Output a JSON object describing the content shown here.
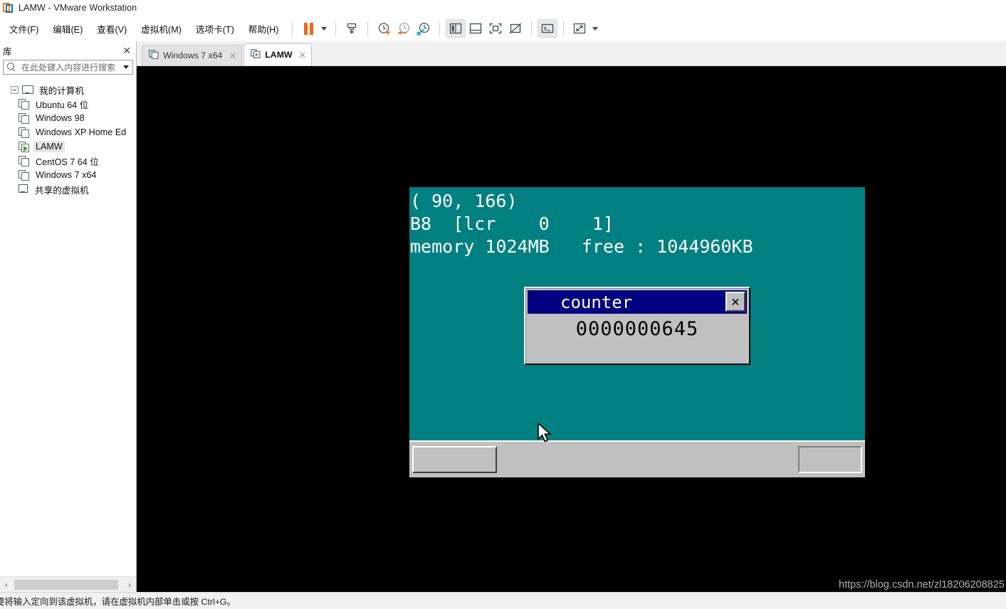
{
  "window": {
    "title": "LAMW - VMware Workstation",
    "logo_icon": "vmware-logo-icon"
  },
  "menubar": {
    "items": [
      {
        "label": "文件(F)",
        "name": "menu-file"
      },
      {
        "label": "编辑(E)",
        "name": "menu-edit"
      },
      {
        "label": "查看(V)",
        "name": "menu-view"
      },
      {
        "label": "虚拟机(M)",
        "name": "menu-vm"
      },
      {
        "label": "选项卡(T)",
        "name": "menu-tabs"
      },
      {
        "label": "帮助(H)",
        "name": "menu-help"
      }
    ]
  },
  "toolbar": {
    "buttons": [
      {
        "name": "suspend-button",
        "icon": "pause-icon",
        "pressed": false
      },
      {
        "name": "power-dropdown",
        "icon": "chevron-down-icon",
        "pressed": false
      },
      {
        "name": "snapshot-button",
        "icon": "snapshot-icon",
        "pressed": false
      },
      {
        "name": "take-snapshot-button",
        "icon": "clock-plus-icon",
        "pressed": false
      },
      {
        "name": "revert-snapshot-button",
        "icon": "clock-back-icon",
        "pressed": false
      },
      {
        "name": "snapshot-manager-button",
        "icon": "clock-wrench-icon",
        "pressed": false
      },
      {
        "name": "show-library-button",
        "icon": "sidebar-panel-icon",
        "pressed": true
      },
      {
        "name": "show-thumbnail-bar-button",
        "icon": "bottom-panel-icon",
        "pressed": false
      },
      {
        "name": "fullscreen-button",
        "icon": "fullscreen-icon",
        "pressed": false
      },
      {
        "name": "unity-mode-button",
        "icon": "unity-mode-icon",
        "pressed": false
      },
      {
        "name": "console-button",
        "icon": "terminal-icon",
        "pressed": true
      },
      {
        "name": "stretch-button",
        "icon": "expand-arrows-icon",
        "pressed": false
      },
      {
        "name": "stretch-dropdown",
        "icon": "chevron-down-icon",
        "pressed": false
      }
    ]
  },
  "library": {
    "title": "库",
    "close_label": "✕",
    "search": {
      "placeholder": "在此处键入内容进行搜索",
      "value": "",
      "icon": "search-icon",
      "dropdown_icon": "chevron-down-icon"
    },
    "tree": [
      {
        "label": "我的计算机",
        "icon": "monitor-icon",
        "level": 0,
        "expanded": true,
        "selected": false,
        "running": false
      },
      {
        "label": "Ubuntu 64 位",
        "icon": "vm-icon",
        "level": 1,
        "expanded": false,
        "selected": false,
        "running": false
      },
      {
        "label": "Windows 98",
        "icon": "vm-icon",
        "level": 1,
        "expanded": false,
        "selected": false,
        "running": false
      },
      {
        "label": "Windows XP Home Ed",
        "icon": "vm-icon",
        "level": 1,
        "expanded": false,
        "selected": false,
        "running": false
      },
      {
        "label": "LAMW",
        "icon": "vm-running-icon",
        "level": 1,
        "expanded": false,
        "selected": true,
        "running": true
      },
      {
        "label": "CentOS 7 64 位",
        "icon": "vm-icon",
        "level": 1,
        "expanded": false,
        "selected": false,
        "running": false
      },
      {
        "label": "Windows 7 x64",
        "icon": "vm-icon",
        "level": 1,
        "expanded": false,
        "selected": false,
        "running": false
      },
      {
        "label": "共享的虚拟机",
        "icon": "shared-vms-icon",
        "level": 0,
        "expanded": false,
        "selected": false,
        "running": false
      }
    ],
    "scrollbar": {
      "left_label": "‹",
      "right_label": "›"
    }
  },
  "tabs": [
    {
      "label": "Windows 7 x64",
      "active": false,
      "icon": "vm-icon",
      "close_label": "✕"
    },
    {
      "label": "LAMW",
      "active": true,
      "icon": "vm-running-icon",
      "close_label": "✕"
    }
  ],
  "vm_screen": {
    "background_color": "#008080",
    "text_color": "#ffffff",
    "lines": [
      "( 90, 166)",
      "B8  [lcr    0    1]",
      "memory 1024MB   free : 1044960KB"
    ],
    "dialog": {
      "title": "counter",
      "title_color": "#000080",
      "close_label": "✕",
      "value": "0000000645",
      "face_color": "#c0c0c0"
    },
    "taskbar": {
      "start_button_label": "",
      "tray_label": ""
    },
    "cursor_icon": "mouse-pointer-icon"
  },
  "statusbar": {
    "text": "要将输入定向到该虚拟机，请在虚拟机内部单击或按 Ctrl+G。"
  },
  "watermark": {
    "text": "https://blog.csdn.net/zl18206208825"
  }
}
